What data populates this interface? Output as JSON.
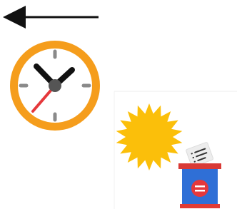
{
  "icons": {
    "back": "arrow-left-icon",
    "clock": "clock-icon",
    "sun": "sun-icon",
    "ballot_box": "ballot-box-icon"
  },
  "colors": {
    "background": "#ffffff",
    "arrow": "#111111",
    "clock_ring": "#f59d1c",
    "clock_face": "#ffffff",
    "clock_hands": "#111111",
    "second_hand": "#e5383b",
    "hour_marks": "#8a8a8a",
    "sun": "#fbbf0a",
    "ballot_box_body": "#2f6fd6",
    "ballot_box_lid": "#d93a36",
    "ballot_box_base": "#e23c34",
    "ballot_emblem": "#e5383b",
    "ballot_paper": "#eeeeee",
    "divider": "#e6e6e6"
  }
}
